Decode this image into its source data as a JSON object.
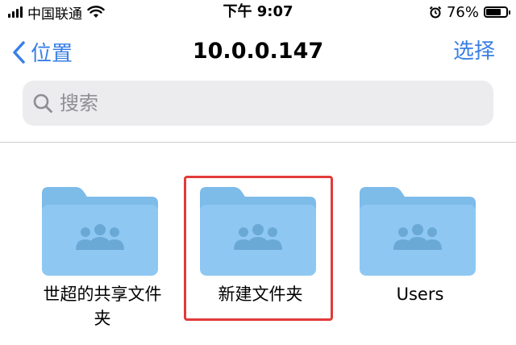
{
  "status_bar": {
    "carrier": "中国联通",
    "time": "下午 9:07",
    "battery_percent": "76%",
    "battery_level": 0.76,
    "icons": [
      "signal-icon",
      "wifi-icon",
      "alarm-icon",
      "battery-icon"
    ]
  },
  "nav": {
    "back_label": "位置",
    "title": "10.0.0.147",
    "select_label": "选择"
  },
  "search": {
    "placeholder": "搜索"
  },
  "folders": [
    {
      "name": "世超的共享文件夹",
      "icon": "shared-folder-icon",
      "highlighted": false
    },
    {
      "name": "新建文件夹",
      "icon": "shared-folder-icon",
      "highlighted": true
    },
    {
      "name": "Users",
      "icon": "shared-folder-icon",
      "highlighted": false
    }
  ],
  "colors": {
    "accent": "#3a7fe6",
    "folder": "#8ec8f2",
    "folder_tab": "#7dbbe9",
    "highlight": "#e23a3a"
  }
}
